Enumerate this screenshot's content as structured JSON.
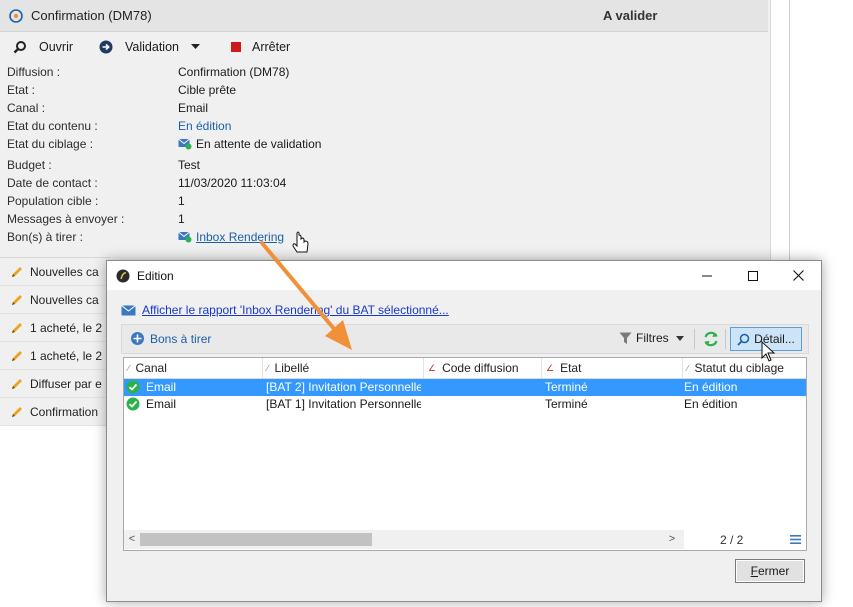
{
  "header": {
    "title": "Confirmation (DM78)",
    "status": "A valider"
  },
  "toolbar": {
    "open_label": "Ouvrir",
    "validation_label": "Validation",
    "stop_label": "Arrêter"
  },
  "fields": [
    {
      "label": "Diffusion :",
      "value": "Confirmation (DM78)"
    },
    {
      "label": "Etat :",
      "value": "Cible prête"
    },
    {
      "label": "Canal :",
      "value": "Email"
    },
    {
      "label": "Etat du contenu :",
      "value": "En édition"
    },
    {
      "label": "Etat du ciblage :",
      "value": "En attente de validation"
    },
    {
      "label": "Budget :",
      "value": "Test"
    },
    {
      "label": "Date de contact :",
      "value": "11/03/2020 11:03:04"
    },
    {
      "label": "Population cible :",
      "value": "1"
    },
    {
      "label": "Messages à envoyer :",
      "value": "1"
    },
    {
      "label": "Bon(s) à tirer :",
      "value": "Inbox Rendering"
    }
  ],
  "list": [
    {
      "label": "Nouvelles ca"
    },
    {
      "label": "Nouvelles ca"
    },
    {
      "label": "1 acheté, le 2"
    },
    {
      "label": "1 acheté, le 2"
    },
    {
      "label": "Diffuser par e"
    },
    {
      "label": "Confirmation"
    }
  ],
  "dialog": {
    "title": "Edition",
    "report_link": "Afficher le rapport 'Inbox Rendering' du BAT sélectionné...",
    "bons_label": "Bons à tirer",
    "filtres_label": "Filtres",
    "detail_label": "Détail...",
    "columns": [
      "Canal",
      "Libellé",
      "Code diffusion",
      "Etat",
      "Statut du ciblage"
    ],
    "rows": [
      {
        "canal": "Email",
        "libelle": "[BAT 2] Invitation Personnelle",
        "code": "",
        "etat": "Terminé",
        "statut": "En édition",
        "selected": true
      },
      {
        "canal": "Email",
        "libelle": "[BAT 1] Invitation Personnelle",
        "code": "",
        "etat": "Terminé",
        "statut": "En édition",
        "selected": false
      }
    ],
    "page_count": "2 / 2",
    "close_label_u": "F",
    "close_label_rest": "ermer"
  },
  "colors": {
    "accent": "#1b5fa8",
    "selection": "#3399ff",
    "arrow": "#f0913a",
    "ok_green": "#2bb24c"
  },
  "icons": {
    "header": "delivery-icon",
    "open": "magnifier-icon",
    "validation": "arrow-circle-icon",
    "stop": "stop-square-icon",
    "list_item": "pencil-icon",
    "report": "envelope-icon",
    "refresh": "refresh-icon",
    "filter": "funnel-icon",
    "row_status": "check-circle-icon"
  }
}
